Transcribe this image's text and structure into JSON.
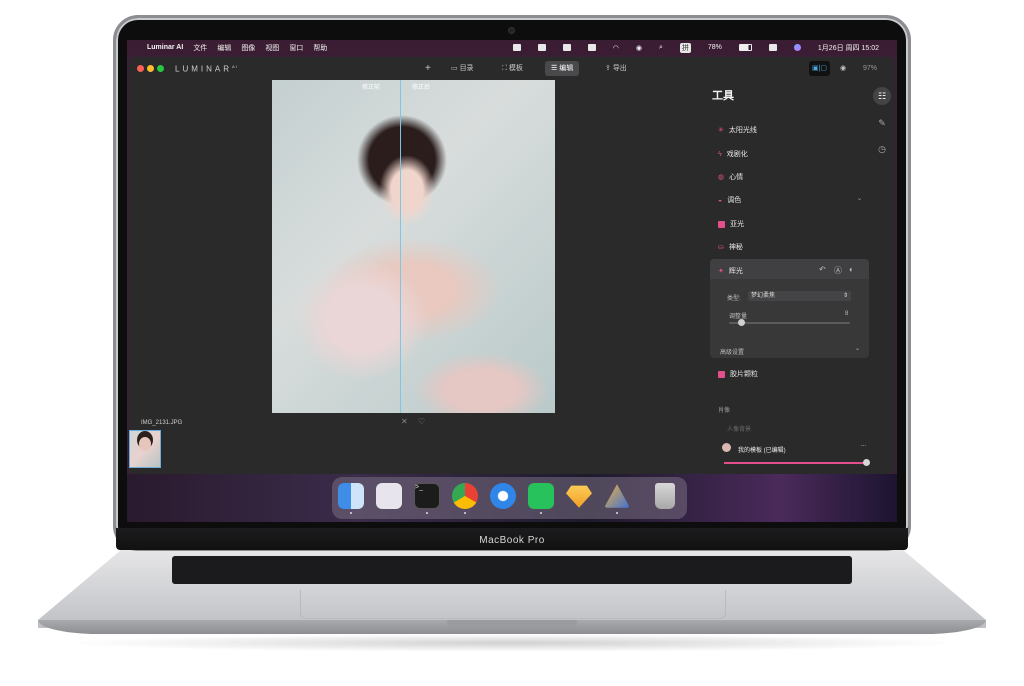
{
  "menubar": {
    "apple": "",
    "items": [
      "Luminar AI",
      "文件",
      "编辑",
      "图像",
      "视图",
      "窗口",
      "帮助"
    ],
    "battery": "78%",
    "datetime": "1月26日 周四 15:02",
    "input_method": "拼"
  },
  "toolbar": {
    "logo": "LUMINAR",
    "logo_sup": "AI",
    "add": "+",
    "catalog": "目录",
    "templates": "模板",
    "edit": "编辑",
    "export": "导出",
    "zoom": "97%"
  },
  "canvas": {
    "before_label": "修正前",
    "after_label": "修正后",
    "filename": "IMG_2131.JPG"
  },
  "panel": {
    "title": "工具",
    "tools": [
      {
        "label": "太阳光线",
        "color": "#e24f8c"
      },
      {
        "label": "戏剧化",
        "color": "#e24f8c"
      },
      {
        "label": "心情",
        "color": "#e24f8c"
      },
      {
        "label": "调色",
        "color": "#e24f8c"
      },
      {
        "label": "亚光",
        "color": "#e24f8c"
      },
      {
        "label": "神秘",
        "color": "#e24f8c"
      }
    ],
    "glow": {
      "label": "辉光",
      "type_label": "类型:",
      "type_value": "梦幻柔焦",
      "amount_label": "调整量",
      "amount_value": "8",
      "advanced": "高级设置"
    },
    "film_grain": "胶片颗粒",
    "portrait_section": "肖像",
    "portrait_sub": "人像背景",
    "my_template": "我的模板 (已编辑)",
    "more": "..."
  },
  "laptop": {
    "brand": "MacBook Pro"
  },
  "colors": {
    "accent": "#e24f8c",
    "split_line": "#7ec6e6"
  }
}
